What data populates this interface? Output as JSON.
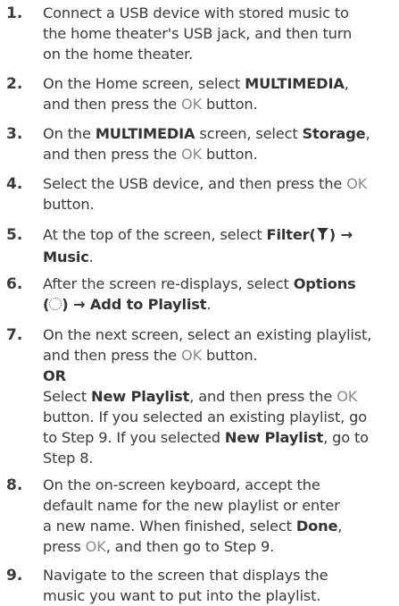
{
  "steps": [
    {
      "num": "1.",
      "lines": [
        {
          "parts": [
            {
              "t": "Connect a USB device with stored music to"
            }
          ]
        },
        {
          "parts": [
            {
              "t": "the home theater's USB jack, and then turn"
            }
          ]
        },
        {
          "parts": [
            {
              "t": "on the home theater."
            }
          ]
        }
      ]
    },
    {
      "num": "2.",
      "lines": [
        {
          "parts": [
            {
              "t": "On the Home screen, select "
            },
            {
              "t": "MULTIMEDIA",
              "s": "b"
            },
            {
              "t": ","
            }
          ]
        },
        {
          "parts": [
            {
              "t": "and then press the "
            },
            {
              "t": "OK",
              "s": "ok"
            },
            {
              "t": " button."
            }
          ]
        }
      ]
    },
    {
      "num": "3.",
      "lines": [
        {
          "parts": [
            {
              "t": "On the "
            },
            {
              "t": "MULTIMEDIA",
              "s": "b"
            },
            {
              "t": " screen, select "
            },
            {
              "t": "Storage",
              "s": "b"
            },
            {
              "t": ","
            }
          ]
        },
        {
          "parts": [
            {
              "t": "and then press the "
            },
            {
              "t": "OK",
              "s": "ok"
            },
            {
              "t": " button."
            }
          ]
        }
      ]
    },
    {
      "num": "4.",
      "lines": [
        {
          "parts": [
            {
              "t": "Select the USB device, and then press the "
            },
            {
              "t": "OK",
              "s": "ok"
            }
          ]
        },
        {
          "parts": [
            {
              "t": "button."
            }
          ]
        }
      ]
    },
    {
      "num": "5.",
      "lines": [
        {
          "parts": [
            {
              "t": "At the top of the screen, select "
            },
            {
              "t": "Filter(",
              "s": "b"
            },
            {
              "icon": "funnel-icon"
            },
            {
              "t": ") →",
              "s": "b"
            }
          ]
        },
        {
          "parts": [
            {
              "t": "Music",
              "s": "b"
            },
            {
              "t": "."
            }
          ]
        }
      ]
    },
    {
      "num": "6.",
      "lines": [
        {
          "parts": [
            {
              "t": "After the screen re-displays, select "
            },
            {
              "t": "Options",
              "s": "b"
            }
          ]
        },
        {
          "parts": [
            {
              "t": "(",
              "s": "b"
            },
            {
              "icon": "gear-icon"
            },
            {
              "t": ") → Add to Playlist",
              "s": "b"
            },
            {
              "t": "."
            }
          ]
        }
      ]
    },
    {
      "num": "7.",
      "lines": [
        {
          "parts": [
            {
              "t": "On the next screen, select an existing playlist,"
            }
          ]
        },
        {
          "parts": [
            {
              "t": "and then press the "
            },
            {
              "t": "OK",
              "s": "ok"
            },
            {
              "t": " button."
            }
          ]
        },
        {
          "parts": [
            {
              "t": "OR",
              "s": "b"
            }
          ]
        },
        {
          "parts": [
            {
              "t": "Select "
            },
            {
              "t": "New Playlist",
              "s": "b"
            },
            {
              "t": ", and then press the "
            },
            {
              "t": "OK",
              "s": "ok"
            }
          ]
        },
        {
          "parts": [
            {
              "t": "button. If you selected an existing playlist, go"
            }
          ]
        },
        {
          "parts": [
            {
              "t": "to Step 9. If you selected "
            },
            {
              "t": "New Playlist",
              "s": "b"
            },
            {
              "t": ", go to"
            }
          ]
        },
        {
          "parts": [
            {
              "t": "Step 8."
            }
          ]
        }
      ]
    },
    {
      "num": "8.",
      "lines": [
        {
          "parts": [
            {
              "t": "On the on-screen keyboard, accept the"
            }
          ]
        },
        {
          "parts": [
            {
              "t": "default name for the new playlist or enter"
            }
          ]
        },
        {
          "parts": [
            {
              "t": "a new name. When finished, select "
            },
            {
              "t": "Done",
              "s": "b"
            },
            {
              "t": ","
            }
          ]
        },
        {
          "parts": [
            {
              "t": "press "
            },
            {
              "t": "OK",
              "s": "ok"
            },
            {
              "t": ", and then go to Step 9."
            }
          ]
        }
      ]
    },
    {
      "num": "9.",
      "lines": [
        {
          "parts": [
            {
              "t": "Navigate to the screen that displays the"
            }
          ]
        },
        {
          "parts": [
            {
              "t": "music you want to put into the playlist."
            }
          ]
        }
      ]
    }
  ]
}
